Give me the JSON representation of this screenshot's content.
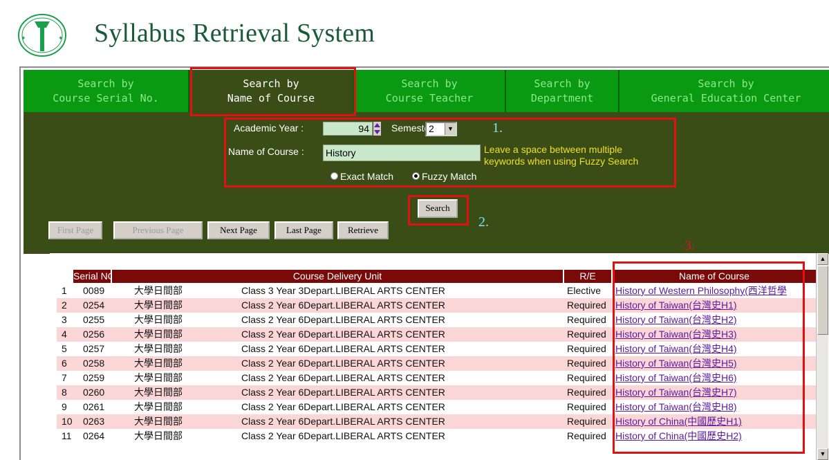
{
  "header": {
    "title": "Syllabus Retrieval System"
  },
  "tabs": [
    {
      "label": "Search by\nCourse Serial No.",
      "active": false
    },
    {
      "label": "Search by\nName of Course",
      "active": true
    },
    {
      "label": "Search by\nCourse Teacher",
      "active": false
    },
    {
      "label": "Search by\nDepartment",
      "active": false
    },
    {
      "label": "Search by\nGeneral Education Center",
      "active": false
    }
  ],
  "form": {
    "year_label": "Academic Year :",
    "year_value": "94",
    "semester_label": "Semester",
    "semester_value": "2",
    "name_label": "Name of Course :",
    "name_value": "History",
    "hint": "Leave a space between multiple\nkeywords when using Fuzzy Search",
    "exact_label": "Exact Match",
    "fuzzy_label": "Fuzzy Match",
    "selected_match": "fuzzy",
    "search_button": "Search"
  },
  "pager": {
    "first": "First Page",
    "previous": "Previous Page",
    "next": "Next Page",
    "last": "Last Page",
    "retrieve": "Retrieve"
  },
  "annotations": {
    "n1": "1.",
    "n2": "2.",
    "n3": "3.",
    "box_color": "#e21111",
    "n1_color": "#7fe3f5",
    "n2_color": "#7fe3f5",
    "n3_color": "#e21111"
  },
  "table": {
    "headers": {
      "serial": "Serial NO.",
      "unit": "Course Delivery Unit",
      "re": "R/E",
      "name": "Name of Course"
    },
    "rows": [
      {
        "idx": "1",
        "serial": "0089",
        "division": "大學日間部",
        "unit": "Class 3 Year 3Depart.LIBERAL ARTS CENTER",
        "re": "Elective",
        "name": "History of Western Philosophy(西洋哲學"
      },
      {
        "idx": "2",
        "serial": "0254",
        "division": "大學日間部",
        "unit": "Class 2 Year 6Depart.LIBERAL ARTS CENTER",
        "re": "Required",
        "name": "History of Taiwan(台灣史H1)"
      },
      {
        "idx": "3",
        "serial": "0255",
        "division": "大學日間部",
        "unit": "Class 2 Year 6Depart.LIBERAL ARTS CENTER",
        "re": "Required",
        "name": "History of Taiwan(台灣史H2)"
      },
      {
        "idx": "4",
        "serial": "0256",
        "division": "大學日間部",
        "unit": "Class 2 Year 6Depart.LIBERAL ARTS CENTER",
        "re": "Required",
        "name": "History of Taiwan(台灣史H3)"
      },
      {
        "idx": "5",
        "serial": "0257",
        "division": "大學日間部",
        "unit": "Class 2 Year 6Depart.LIBERAL ARTS CENTER",
        "re": "Required",
        "name": "History of Taiwan(台灣史H4)"
      },
      {
        "idx": "6",
        "serial": "0258",
        "division": "大學日間部",
        "unit": "Class 2 Year 6Depart.LIBERAL ARTS CENTER",
        "re": "Required",
        "name": "History of Taiwan(台灣史H5)"
      },
      {
        "idx": "7",
        "serial": "0259",
        "division": "大學日間部",
        "unit": "Class 2 Year 6Depart.LIBERAL ARTS CENTER",
        "re": "Required",
        "name": "History of Taiwan(台灣史H6)"
      },
      {
        "idx": "8",
        "serial": "0260",
        "division": "大學日間部",
        "unit": "Class 2 Year 6Depart.LIBERAL ARTS CENTER",
        "re": "Required",
        "name": "History of Taiwan(台灣史H7)"
      },
      {
        "idx": "9",
        "serial": "0261",
        "division": "大學日間部",
        "unit": "Class 2 Year 6Depart.LIBERAL ARTS CENTER",
        "re": "Required",
        "name": "History of Taiwan(台灣史H8)"
      },
      {
        "idx": "10",
        "serial": "0263",
        "division": "大學日間部",
        "unit": "Class 2 Year 6Depart.LIBERAL ARTS CENTER",
        "re": "Required",
        "name": "History of China(中國歷史H1)"
      },
      {
        "idx": "11",
        "serial": "0264",
        "division": "大學日間部",
        "unit": "Class 2 Year 6Depart.LIBERAL ARTS CENTER",
        "re": "Required",
        "name": "History of China(中國歷史H2)"
      }
    ]
  }
}
